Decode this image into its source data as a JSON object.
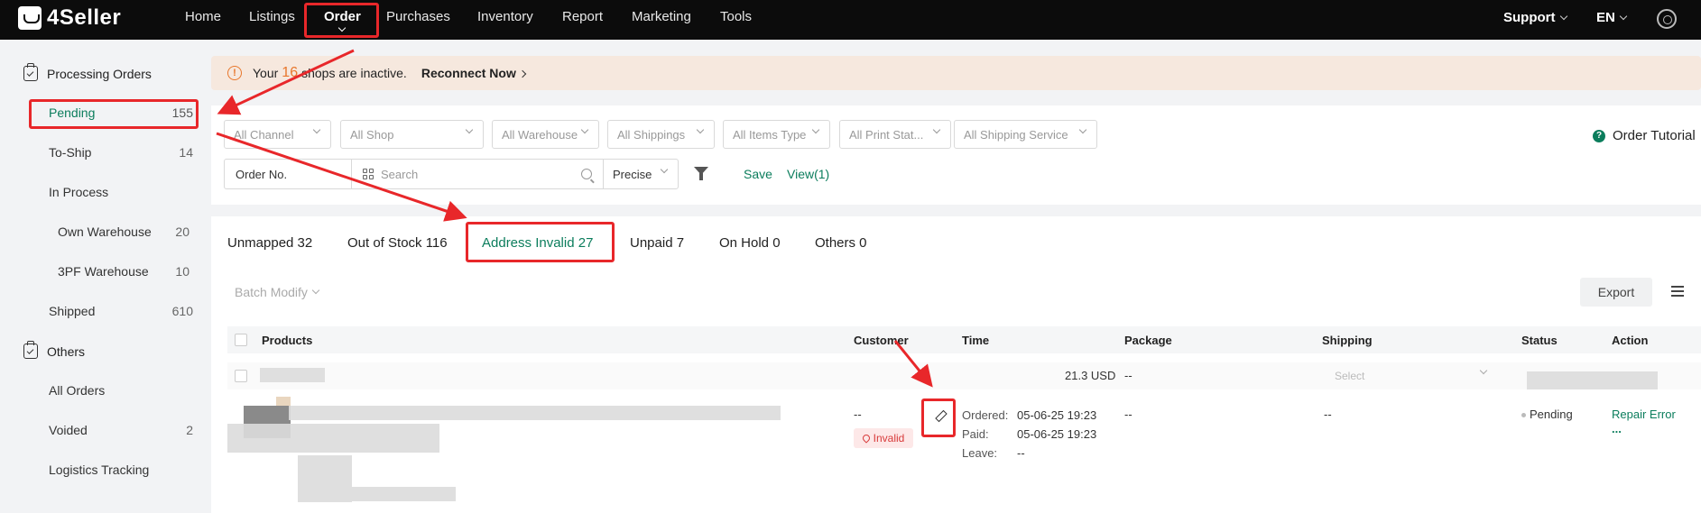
{
  "nav": {
    "logo": "4Seller",
    "items": [
      "Home",
      "Listings",
      "Order",
      "Purchases",
      "Inventory",
      "Report",
      "Marketing",
      "Tools"
    ],
    "support": "Support",
    "language": "EN"
  },
  "sidebar": {
    "processing_title": "Processing Orders",
    "pending": {
      "label": "Pending",
      "count": "155"
    },
    "to_ship": {
      "label": "To-Ship",
      "count": "14"
    },
    "in_process": {
      "label": "In Process"
    },
    "own_warehouse": {
      "label": "Own Warehouse",
      "count": "20"
    },
    "pf_warehouse": {
      "label": "3PF Warehouse",
      "count": "10"
    },
    "shipped": {
      "label": "Shipped",
      "count": "610"
    },
    "others_title": "Others",
    "all_orders": {
      "label": "All Orders"
    },
    "voided": {
      "label": "Voided",
      "count": "2"
    },
    "logistics": {
      "label": "Logistics Tracking"
    }
  },
  "notice": {
    "prefix": "Your",
    "count": "16",
    "suffix": "shops are inactive.",
    "action": "Reconnect Now"
  },
  "filters": {
    "channel": "All Channel",
    "shop": "All Shop",
    "warehouse": "All Warehouse",
    "shippings": "All Shippings",
    "items_type": "All Items Type",
    "print_status": "All Print Stat...",
    "shipping_service": "All Shipping Service",
    "tutorial": "Order Tutorial",
    "order_no": "Order No.",
    "search_placeholder": "Search",
    "precise": "Precise",
    "save": "Save",
    "view": "View(1)"
  },
  "tabs": [
    "Unmapped 32",
    "Out of Stock 116",
    "Address Invalid 27",
    "Unpaid 7",
    "On Hold 0",
    "Others 0"
  ],
  "toolbar": {
    "batch_modify": "Batch Modify",
    "export": "Export"
  },
  "table": {
    "headers": {
      "products": "Products",
      "customer": "Customer",
      "time": "Time",
      "package": "Package",
      "shipping": "Shipping",
      "status": "Status",
      "action": "Action"
    },
    "summary": {
      "amount": "21.3 USD",
      "package": "--",
      "shipping_select": "Select"
    },
    "row": {
      "customer": "--",
      "invalid_tag": "Invalid",
      "ordered_label": "Ordered:",
      "ordered_value": "05-06-25 19:23",
      "paid_label": "Paid:",
      "paid_value": "05-06-25 19:23",
      "leave_label": "Leave:",
      "leave_value": "--",
      "package": "--",
      "shipping": "--",
      "status": "Pending",
      "action": "Repair Error",
      "more": "..."
    }
  },
  "colors": {
    "brand_green": "#0b7d5c",
    "annotation_red": "#e8272a",
    "warning_orange": "#e8772c"
  }
}
